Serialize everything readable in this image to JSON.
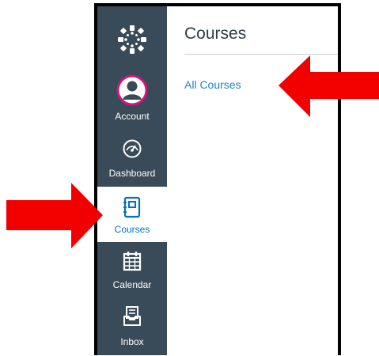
{
  "nav": {
    "items": [
      {
        "label": "Account",
        "icon": "avatar-icon"
      },
      {
        "label": "Dashboard",
        "icon": "dashboard-gauge-icon"
      },
      {
        "label": "Courses",
        "icon": "courses-book-icon",
        "active": true
      },
      {
        "label": "Calendar",
        "icon": "calendar-icon"
      },
      {
        "label": "Inbox",
        "icon": "inbox-icon"
      }
    ]
  },
  "panel": {
    "title": "Courses",
    "links": [
      "All Courses"
    ]
  },
  "colors": {
    "sidebar": "#394b58",
    "active_text": "#0a70c4",
    "link": "#2185c8",
    "avatar_ring": "#d4137e",
    "arrow": "#f20000"
  }
}
